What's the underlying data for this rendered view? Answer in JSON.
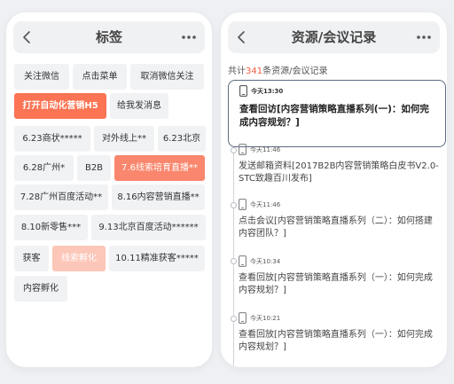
{
  "left": {
    "title": "标签",
    "tags": [
      {
        "label": "关注微信",
        "state": "normal"
      },
      {
        "label": "点击菜单",
        "state": "normal"
      },
      {
        "label": "取消微信关注",
        "state": "normal"
      },
      {
        "label": "打开自动化营销H5",
        "state": "active"
      },
      {
        "label": "给我发消息",
        "state": "normal"
      },
      {
        "label": "6.23商状*****",
        "state": "normal"
      },
      {
        "label": "对外线上**",
        "state": "normal"
      },
      {
        "label": "6.23北京",
        "state": "normal"
      },
      {
        "label": "6.28广州*",
        "state": "normal"
      },
      {
        "label": "B2B",
        "state": "normal"
      },
      {
        "label": "7.6线索培育直播**",
        "state": "selected"
      },
      {
        "label": "7.28广州百度活动**",
        "state": "normal"
      },
      {
        "label": "8.16内容营销直播**",
        "state": "normal"
      },
      {
        "label": "8.10新零售***",
        "state": "normal"
      },
      {
        "label": "9.13北京百度活动******",
        "state": "normal"
      },
      {
        "label": "获客",
        "state": "normal"
      },
      {
        "label": "线索孵化",
        "state": "light"
      },
      {
        "label": "10.11精准获客*****",
        "state": "normal"
      },
      {
        "label": "内容孵化",
        "state": "normal"
      }
    ]
  },
  "right": {
    "title": "资源/会议记录",
    "total_prefix": "共计",
    "total_count": "341",
    "total_suffix": "条资源/会议记录",
    "highlight": {
      "time": "今天13:30",
      "text": "查看回访[内容营销策略直播系列(一)：如何完成内容规划？]"
    },
    "records": [
      {
        "time": "今天11:46",
        "text": "发送邮箱资料[2017B2B内容营销策略白皮书V2.0-STC致趣百川发布]"
      },
      {
        "time": "今天11:46",
        "text": "点击会议[内容营销策略直播系列（二）：如何搭建内容团队？]"
      },
      {
        "time": "今天10:34",
        "text": "查看回放[内容营销策略直播系列（一）：如何完成内容规划？]"
      },
      {
        "time": "今天10:21",
        "text": "查看回放[内容营销策略直播系列（一）：如何完成内容规划？]"
      }
    ]
  },
  "colors": {
    "accent": "#fb7453",
    "selected": "#f9866d",
    "light": "#fcc6b8",
    "count": "#f25a3c"
  },
  "icons": [
    "back-chevron-icon",
    "more-dots-icon",
    "phone-icon"
  ]
}
